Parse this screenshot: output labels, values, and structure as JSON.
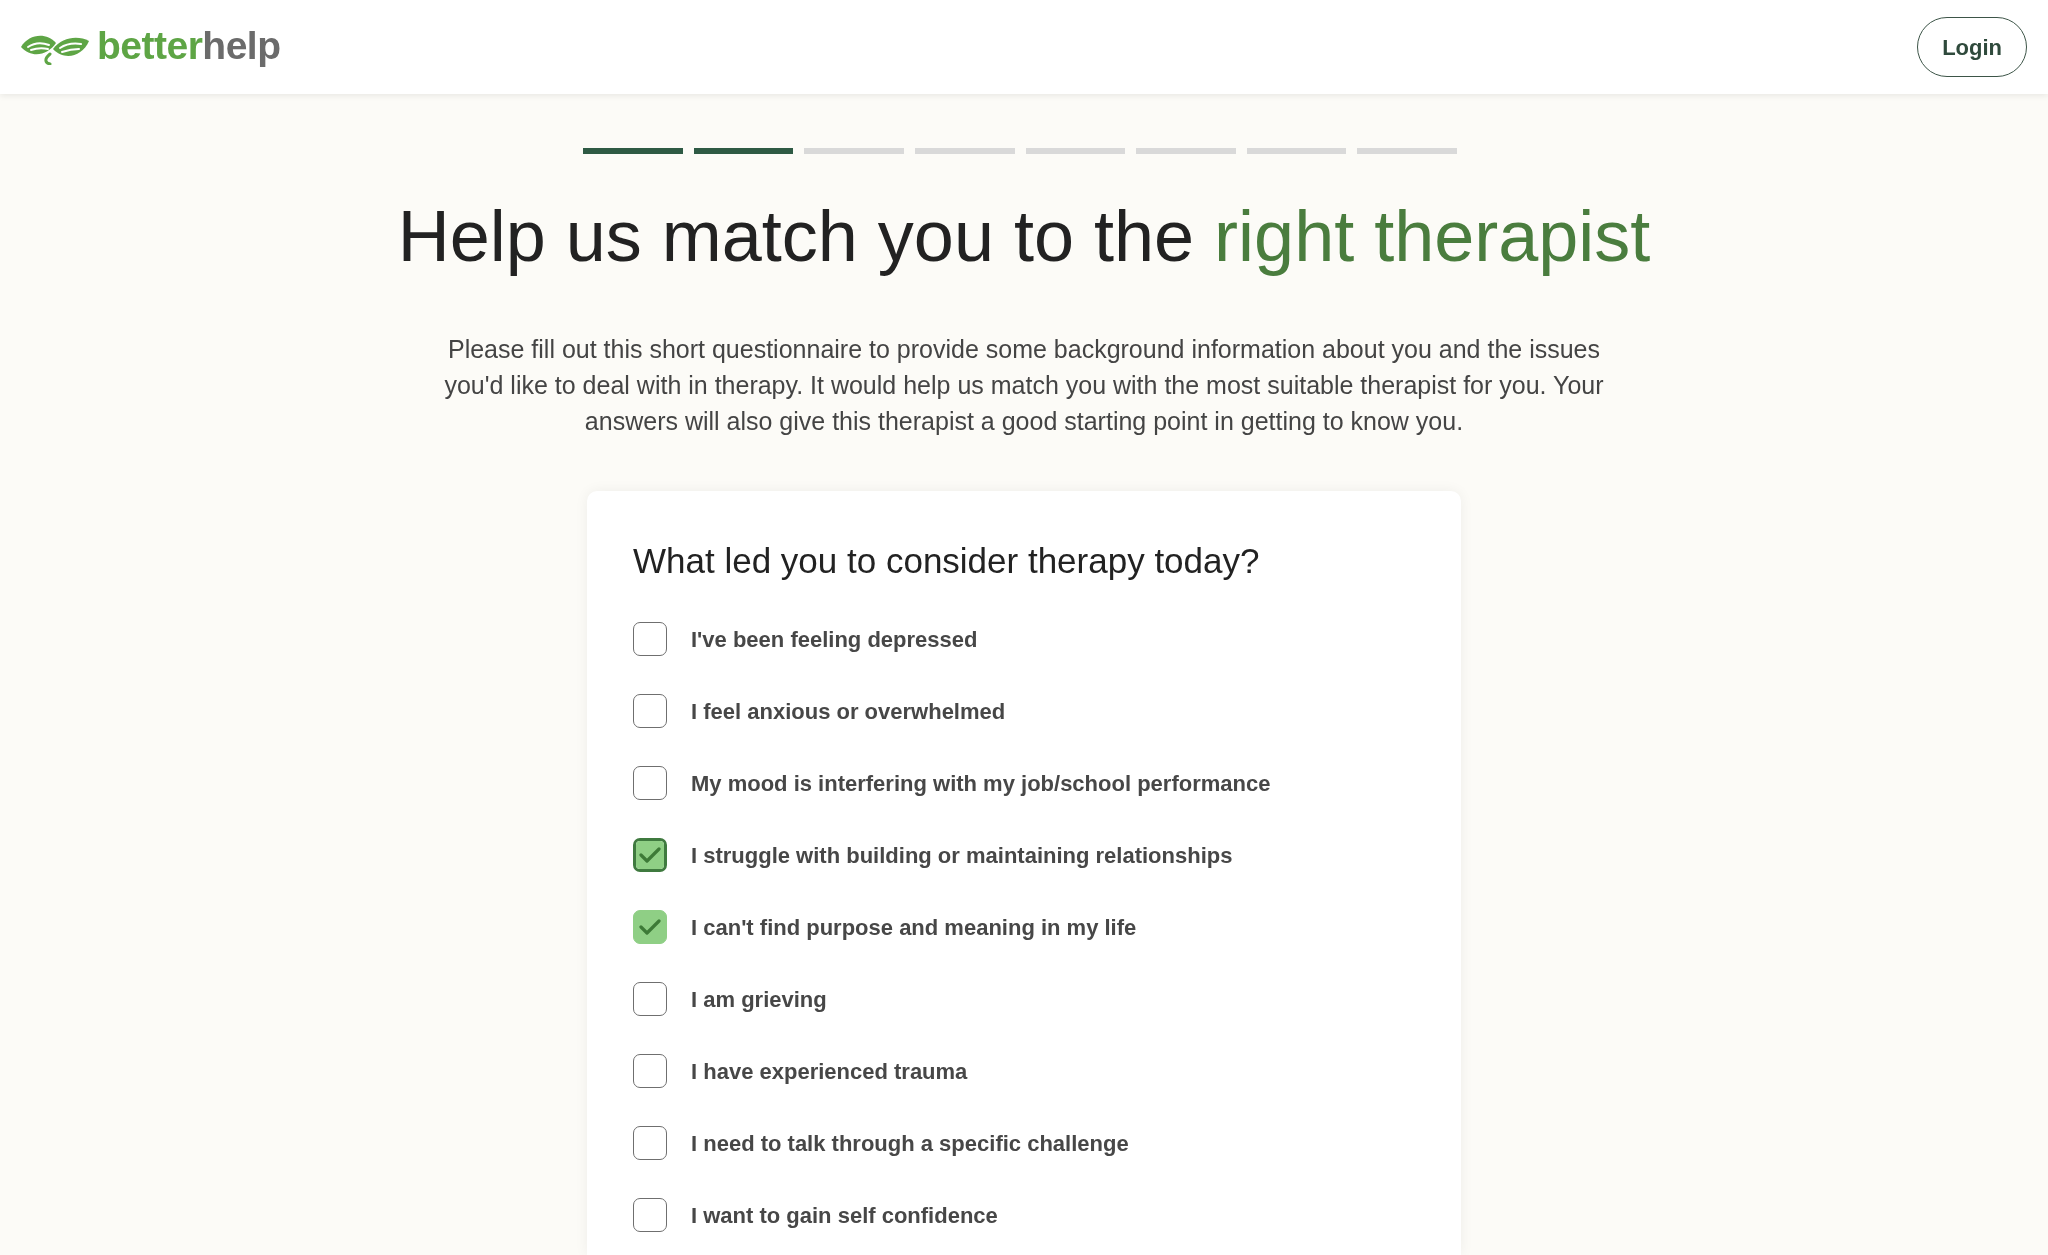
{
  "header": {
    "logo": {
      "primary": "better",
      "secondary": "help"
    },
    "login_button": "Login"
  },
  "progress": {
    "steps": [
      {
        "completed": true
      },
      {
        "completed": true
      },
      {
        "completed": false
      },
      {
        "completed": false
      },
      {
        "completed": false
      },
      {
        "completed": false
      },
      {
        "completed": false
      },
      {
        "completed": false
      }
    ]
  },
  "title": {
    "text": "Help us match you to the",
    "highlight": "right therapist"
  },
  "intro": "Please fill out this short questionnaire to provide some background information about you and the issues you'd like to deal with in therapy. It would help us match you with the most suitable therapist for you. Your answers will also give this therapist a good starting point in getting to know you.",
  "question": {
    "prompt": "What led you to consider therapy today?",
    "options": [
      {
        "label": "I've been feeling depressed",
        "checked": false,
        "focused": false
      },
      {
        "label": "I feel anxious or overwhelmed",
        "checked": false,
        "focused": false
      },
      {
        "label": "My mood is interfering with my job/school performance",
        "checked": false,
        "focused": false
      },
      {
        "label": "I struggle with building or maintaining relationships",
        "checked": true,
        "focused": true
      },
      {
        "label": "I can't find purpose and meaning in my life",
        "checked": true,
        "focused": false
      },
      {
        "label": "I am grieving",
        "checked": false,
        "focused": false
      },
      {
        "label": "I have experienced trauma",
        "checked": false,
        "focused": false
      },
      {
        "label": "I need to talk through a specific challenge",
        "checked": false,
        "focused": false
      },
      {
        "label": "I want to gain self confidence",
        "checked": false,
        "focused": false
      }
    ]
  }
}
